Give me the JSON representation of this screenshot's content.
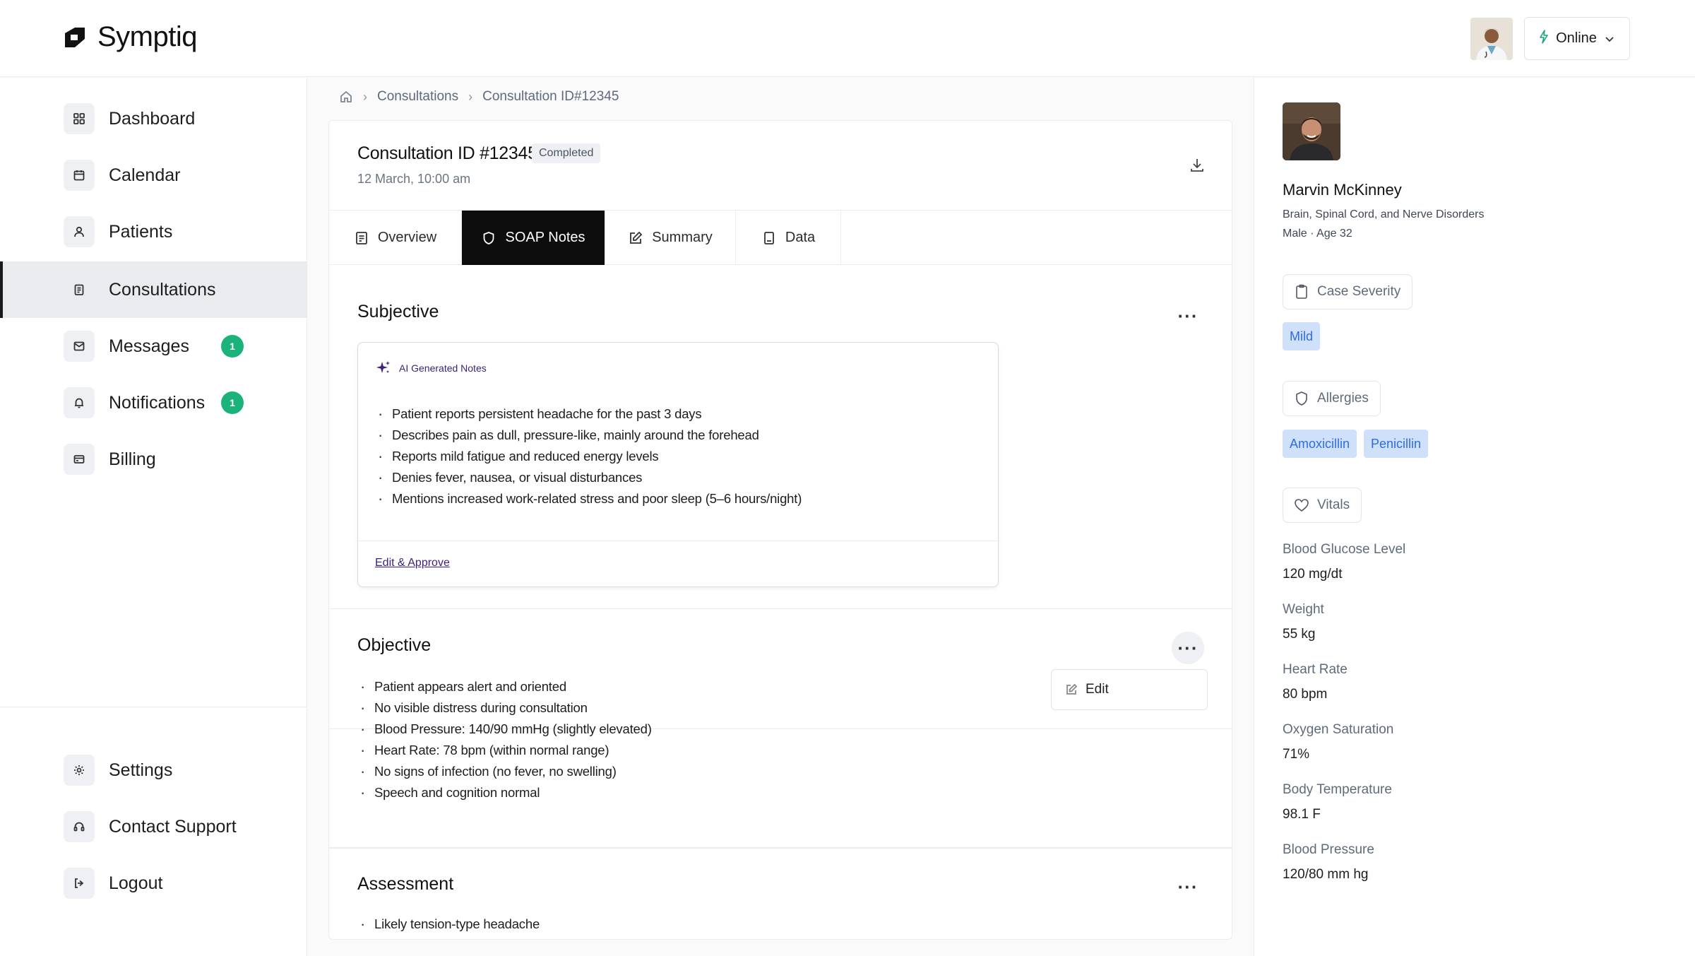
{
  "header": {
    "brand": "Symptiq",
    "status": "Online"
  },
  "sidebar": {
    "items": [
      {
        "label": "Dashboard",
        "icon": "grid-icon"
      },
      {
        "label": "Calendar",
        "icon": "calendar-icon"
      },
      {
        "label": "Patients",
        "icon": "user-icon"
      },
      {
        "label": "Consultations",
        "icon": "clipboard-icon",
        "active": true
      },
      {
        "label": "Messages",
        "icon": "mail-icon",
        "badge": "1"
      },
      {
        "label": "Notifications",
        "icon": "bell-icon",
        "badge": "1"
      },
      {
        "label": "Billing",
        "icon": "card-icon"
      }
    ],
    "bottom": [
      {
        "label": "Settings",
        "icon": "gear-icon"
      },
      {
        "label": "Contact Support",
        "icon": "headset-icon"
      },
      {
        "label": "Logout",
        "icon": "logout-icon"
      }
    ]
  },
  "breadcrumb": {
    "items": [
      "Consultations",
      "Consultation ID#12345"
    ]
  },
  "consultation": {
    "title": "Consultation ID #12345",
    "status": "Completed",
    "date": "12 March, 10:00 am"
  },
  "tabs": [
    "Overview",
    "SOAP Notes",
    "Summary",
    "Data"
  ],
  "subjective": {
    "title": "Subjective",
    "ai_label": "AI Generated Notes",
    "items": [
      "Patient reports persistent headache for the past 3 days",
      "Describes pain as dull, pressure-like, mainly around the forehead",
      "Reports mild fatigue and reduced energy levels",
      "Denies fever, nausea, or visual disturbances",
      "Mentions increased work-related stress and poor sleep (5–6 hours/night)"
    ],
    "action": "Edit & Approve"
  },
  "objective": {
    "title": "Objective",
    "edit_label": "Edit",
    "items": [
      "Patient appears alert and oriented",
      "No visible distress during consultation",
      "Blood Pressure: 140/90 mmHg (slightly elevated)",
      "Heart Rate: 78 bpm (within normal range)",
      "No signs of infection (no fever, no swelling)",
      "Speech and cognition normal"
    ]
  },
  "assessment": {
    "title": "Assessment",
    "items": [
      "Likely tension-type headache"
    ]
  },
  "patient": {
    "name": "Marvin McKinney",
    "specialty": "Brain, Spinal Cord, and Nerve Disorders",
    "meta": "Male · Age 32",
    "severity_label": "Case Severity",
    "severity": "Mild",
    "allergies_label": "Allergies",
    "allergies": [
      "Amoxicillin",
      "Penicillin"
    ],
    "vitals_label": "Vitals",
    "vitals": [
      {
        "label": "Blood Glucose Level",
        "value": "120 mg/dt"
      },
      {
        "label": "Weight",
        "value": "55 kg"
      },
      {
        "label": "Heart Rate",
        "value": "80 bpm"
      },
      {
        "label": "Oxygen Saturation",
        "value": "71%"
      },
      {
        "label": "Body Temperature",
        "value": "98.1 F"
      },
      {
        "label": "Blood Pressure",
        "value": "120/80 mm hg"
      }
    ]
  },
  "colors": {
    "accent": "#1bb37a",
    "ai": "#3b1f7a",
    "tag_bg": "#cfe0fb",
    "tag_text": "#2f6ce0"
  }
}
